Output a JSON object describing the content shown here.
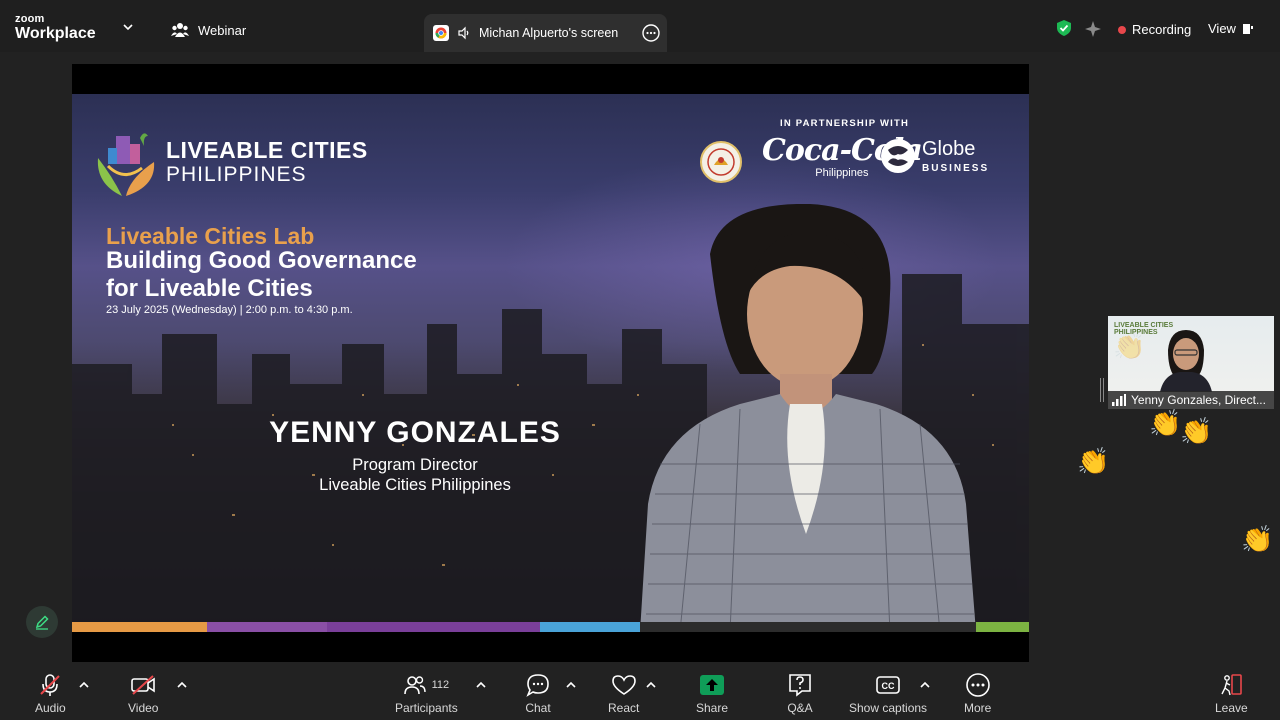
{
  "app": {
    "brand_top": "zoom",
    "brand_bottom": "Workplace",
    "mode": "Webinar"
  },
  "share_tab": {
    "label": "Michan Alpuerto's screen"
  },
  "status": {
    "recording": "Recording",
    "view": "View"
  },
  "slide": {
    "logo_line1": "LIVEABLE CITIES",
    "logo_line2": "PHILIPPINES",
    "partnership": "IN PARTNERSHIP WITH",
    "coke_line1": "Coca-Cola",
    "coke_line2": "Philippines",
    "globe_line1": "Globe",
    "globe_line2": "BUSINESS",
    "lab_title": "Liveable Cities Lab",
    "headline_1": "Building Good Governance",
    "headline_2": "for Liveable Cities",
    "date": "23 July 2025 (Wednesday) | 2:00 p.m. to 4:30 p.m.",
    "speaker_name": "YENNY GONZALES",
    "speaker_role": "Program Director",
    "speaker_org": "Liveable Cities Philippines",
    "stripe_colors": [
      "#e69a45",
      "#8a4fa6",
      "#7a3f9a",
      "#4aa3d8",
      "#2c2c2c",
      "#7cb342"
    ]
  },
  "thumbnail": {
    "name": "Yenny Gonzales, Direct...",
    "mini_logo_1": "LIVEABLE CITIES",
    "mini_logo_2": "PHILIPPINES"
  },
  "toolbar": {
    "audio": "Audio",
    "video": "Video",
    "participants": "Participants",
    "participant_count": "112",
    "chat": "Chat",
    "react": "React",
    "share": "Share",
    "qa": "Q&A",
    "captions": "Show captions",
    "cc": "CC",
    "more": "More",
    "leave": "Leave"
  },
  "colors": {
    "share_green": "#0f9d58",
    "recording_red": "#e8474b",
    "shield_green": "#1db954"
  }
}
